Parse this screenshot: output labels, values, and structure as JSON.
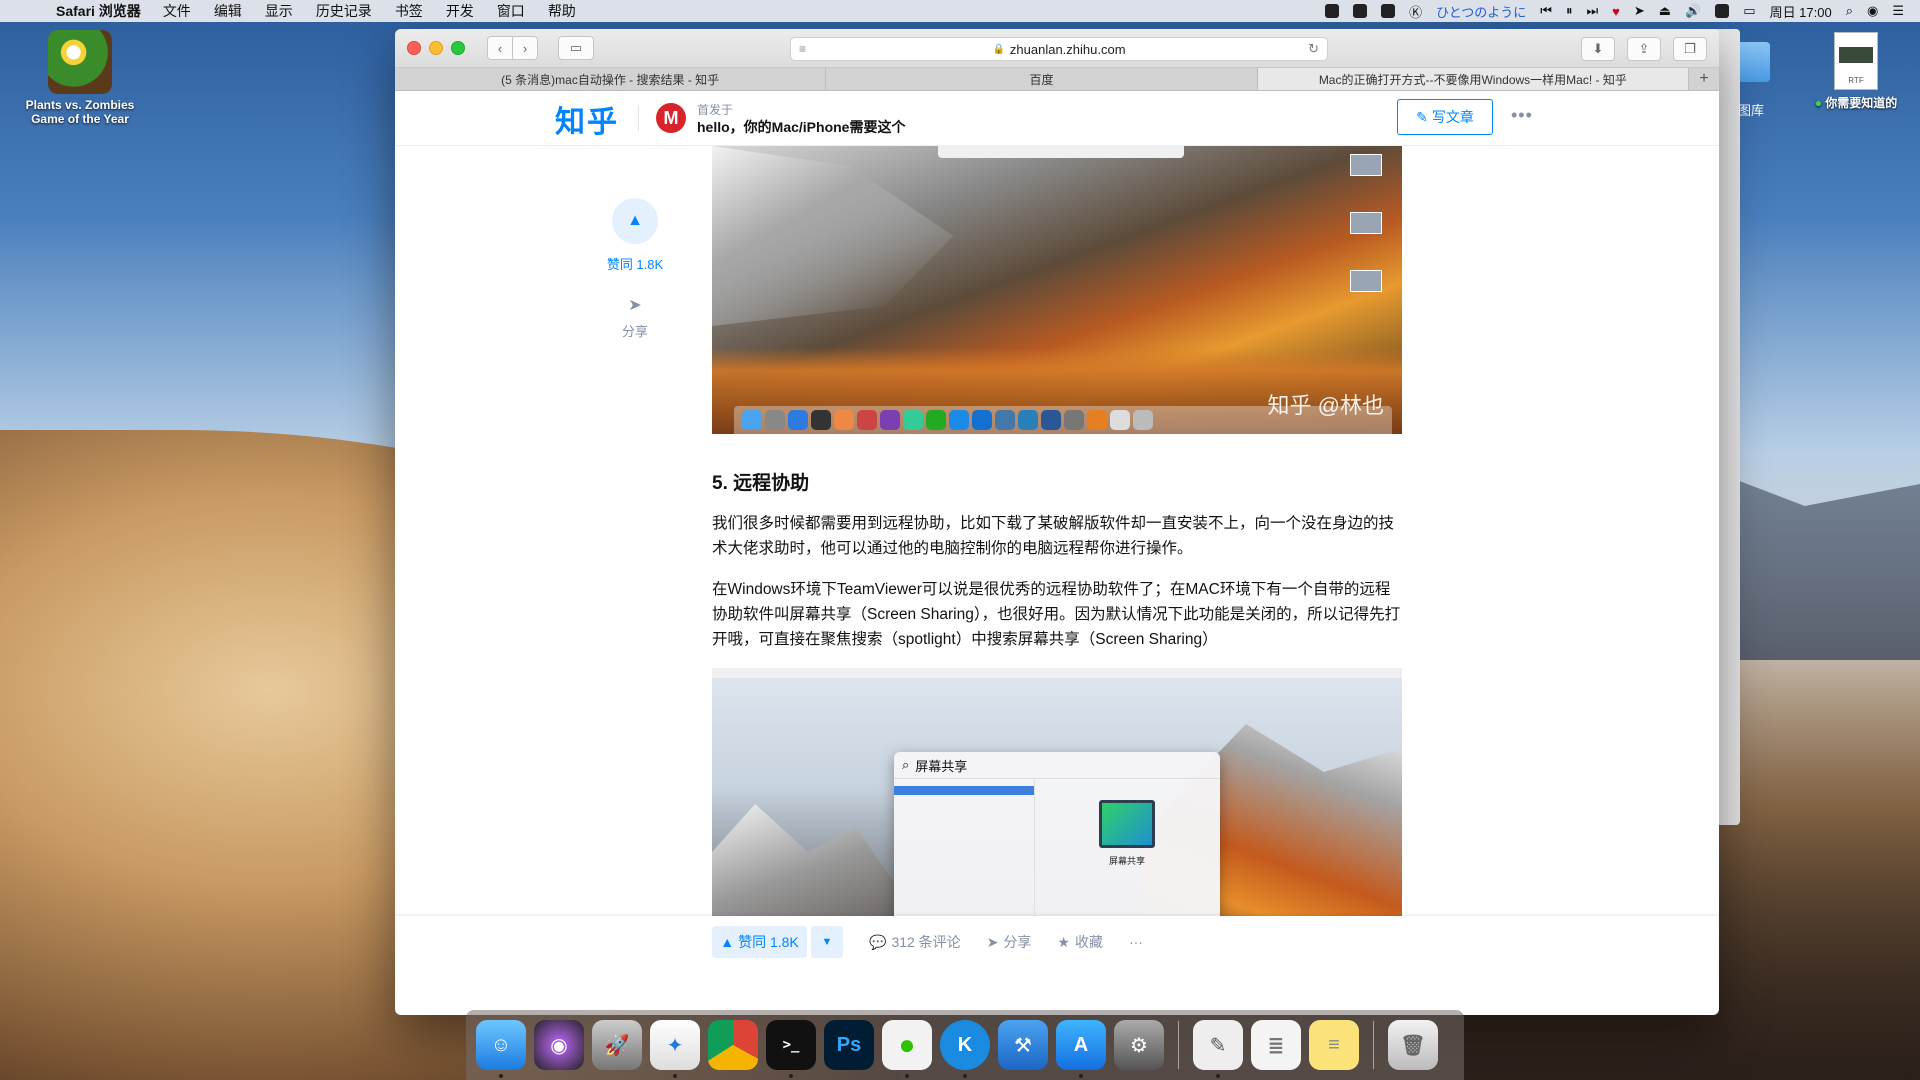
{
  "menubar": {
    "app_name": "Safari 浏览器",
    "items": [
      "文件",
      "编辑",
      "显示",
      "历史记录",
      "书签",
      "开发",
      "窗口",
      "帮助"
    ],
    "tray_text": "ひとつのように",
    "clock": "周日 17:00"
  },
  "desktop": {
    "pvz_label_line1": "Plants vs. Zombies",
    "pvz_label_line2": "Game of the Year",
    "rtf_badge": "RTF",
    "rtf_label": "你需要知道的",
    "photos_label": "图库"
  },
  "safari": {
    "url": "zhuanlan.zhihu.com",
    "tabs": [
      "(5 条消息)mac自动操作 - 搜索结果 - 知乎",
      "百度",
      "Mac的正确打开方式--不要像用Windows一样用Mac! - 知乎"
    ]
  },
  "zhihu": {
    "logo": "知乎",
    "first_published": "首发于",
    "column_name": "hello，你的Mac/iPhone需要这个",
    "write_article": "写文章",
    "vote_count": "赞同 1.8K",
    "share": "分享"
  },
  "article": {
    "image1_watermark": "知乎 @林也",
    "section_heading": "5. 远程协助",
    "para1": "我们很多时候都需要用到远程协助，比如下载了某破解版软件却一直安装不上，向一个没在身边的技术大佬求助时，他可以通过他的电脑控制你的电脑远程帮你进行操作。",
    "para2": "在Windows环境下TeamViewer可以说是很优秀的远程协助软件了；在MAC环境下有一个自带的远程协助软件叫屏幕共享（Screen Sharing），也很好用。因为默认情况下此功能是关闭的，所以记得先打开哦，可直接在聚焦搜索（spotlight）中搜索屏幕共享（Screen Sharing）",
    "spotlight_query": "屏幕共享",
    "spotlight_app_name": "屏幕共享"
  },
  "actionbar": {
    "vote": "赞同 1.8K",
    "comments": "312 条评论",
    "share": "分享",
    "collect": "收藏",
    "more": "···"
  },
  "colors": {
    "zhihu_blue": "#0084ff",
    "zhihu_blue_light": "#e5f0ff"
  }
}
